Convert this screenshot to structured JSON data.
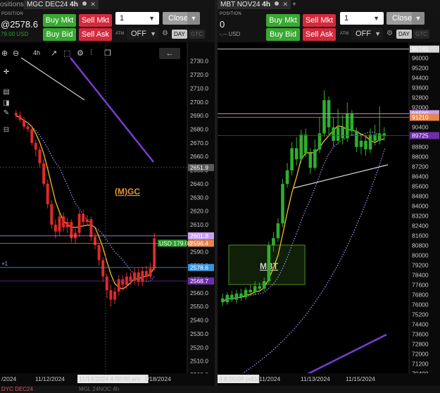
{
  "left": {
    "tabs": [
      {
        "label": "ositions"
      },
      {
        "label": "MGC DEC24",
        "interval": "4h"
      }
    ],
    "position_label": "POSITION",
    "position_value": "@2578.6",
    "position_sub": "79.00 USD",
    "buttons": {
      "buy_mkt": "Buy Mkt",
      "sell_mkt": "Sell Mkt",
      "buy_bid": "Buy Bid",
      "sell_ask": "Sell Ask",
      "close": "Close"
    },
    "quantity": "1",
    "atm_label": "ATM",
    "atm_value": "OFF",
    "tif": {
      "day": "DAY",
      "gtc": "GTC"
    },
    "toolbar_interval": "4h",
    "chart_data": {
      "type": "candlestick",
      "instrument": "MGC DEC24",
      "watermark": "(M)GC",
      "y_ticks": [
        "2730.0",
        "2720.0",
        "2710.0",
        "2700.0",
        "2690.0",
        "2680.0",
        "2670.0",
        "2660.0",
        "2650.0",
        "2640.0",
        "2630.0",
        "2620.0",
        "2610.0",
        "2600.0",
        "2590.0",
        "2580.0",
        "2570.0",
        "2560.0",
        "2550.0",
        "2540.0",
        "2530.0",
        "2520.0",
        "2510.0",
        "2500.0"
      ],
      "ylim": [
        2500,
        2735
      ],
      "x_labels": [
        "/2024",
        "11/12/2024",
        "11/14/2024 4:00:00 am",
        "1/18/2024"
      ],
      "price_tags": [
        {
          "label": "2651.9",
          "value": 2651.9,
          "color": "#5a5a5a"
        },
        {
          "label": "2601.8",
          "value": 2601.8,
          "color": "#c9a0f0"
        },
        {
          "label": "2596.4",
          "value": 2596.4,
          "color": "#e8864e"
        },
        {
          "label": "USD 179.00",
          "value": 2596.4,
          "color": "#2d9e2d"
        },
        {
          "label": "2578.6",
          "value": 2578.6,
          "color": "#3b93d6"
        },
        {
          "label": "2568.7",
          "value": 2568.7,
          "color": "#6e2ea8"
        }
      ],
      "qty_marker": "+1",
      "candles": [
        [
          2692,
          2690,
          2694,
          2688
        ],
        [
          2690,
          2687,
          2693,
          2685
        ],
        [
          2687,
          2682,
          2689,
          2680
        ],
        [
          2682,
          2680,
          2685,
          2678
        ],
        [
          2680,
          2670,
          2683,
          2668
        ],
        [
          2670,
          2665,
          2672,
          2660
        ],
        [
          2665,
          2655,
          2667,
          2652
        ],
        [
          2655,
          2640,
          2658,
          2638
        ],
        [
          2640,
          2625,
          2643,
          2622
        ],
        [
          2625,
          2610,
          2628,
          2607
        ],
        [
          2610,
          2605,
          2614,
          2600
        ],
        [
          2605,
          2616,
          2618,
          2602
        ],
        [
          2616,
          2608,
          2619,
          2605
        ],
        [
          2608,
          2612,
          2615,
          2604
        ],
        [
          2612,
          2600,
          2614,
          2597
        ],
        [
          2600,
          2604,
          2607,
          2596
        ],
        [
          2604,
          2618,
          2620,
          2601
        ],
        [
          2618,
          2612,
          2621,
          2608
        ],
        [
          2612,
          2614,
          2617,
          2609
        ],
        [
          2614,
          2601,
          2616,
          2598
        ],
        [
          2601,
          2595,
          2604,
          2592
        ],
        [
          2595,
          2584,
          2597,
          2580
        ],
        [
          2584,
          2572,
          2586,
          2568
        ],
        [
          2572,
          2562,
          2574,
          2556
        ],
        [
          2562,
          2555,
          2566,
          2550
        ],
        [
          2555,
          2561,
          2564,
          2552
        ],
        [
          2561,
          2570,
          2573,
          2558
        ],
        [
          2570,
          2566,
          2573,
          2562
        ],
        [
          2566,
          2572,
          2575,
          2563
        ],
        [
          2572,
          2569,
          2575,
          2566
        ],
        [
          2569,
          2575,
          2578,
          2566
        ],
        [
          2575,
          2568,
          2578,
          2565
        ],
        [
          2568,
          2576,
          2579,
          2565
        ],
        [
          2576,
          2572,
          2580,
          2569
        ],
        [
          2572,
          2578,
          2582,
          2570
        ],
        [
          2578,
          2600,
          2604,
          2576
        ]
      ]
    }
  },
  "right": {
    "tabs": [
      {
        "label": "MBT NOV24",
        "interval": "4h"
      }
    ],
    "position_label": "POSITION",
    "position_value": "0",
    "position_sub": "-.-- USD",
    "buttons": {
      "buy_mkt": "Buy Mkt",
      "sell_mkt": "Sell Mkt",
      "buy_bid": "Buy Bid",
      "sell_ask": "Sell Ask",
      "close": "Close"
    },
    "quantity": "1",
    "atm_label": "ATM",
    "atm_value": "OFF",
    "tif": {
      "day": "DAY",
      "gtc": "GTC"
    },
    "chart_data": {
      "type": "candlestick",
      "instrument": "MBT NOV24",
      "box_label": "MBT",
      "y_ticks": [
        "96745",
        "96000",
        "95200",
        "94400",
        "93600",
        "92800",
        "92000",
        "91200",
        "90400",
        "89600",
        "88800",
        "88000",
        "87200",
        "86400",
        "85600",
        "84800",
        "84000",
        "83200",
        "82400",
        "81600",
        "80800",
        "80000",
        "79200",
        "78400",
        "77600",
        "76800",
        "76000",
        "75200",
        "74400",
        "73600",
        "72800",
        "72000",
        "71200",
        "70400"
      ],
      "ylim": [
        70200,
        96900
      ],
      "x_labels": [
        "4 8:00:00 pm",
        "11/11/2024",
        "11/13/2024",
        "11/15/2024"
      ],
      "price_tags": [
        {
          "label": "96745",
          "value": 96745,
          "color": "#d9d9d9"
        },
        {
          "label": "91500",
          "value": 91500,
          "color": "#c9a0f0"
        },
        {
          "label": "91210",
          "value": 91210,
          "color": "#e8864e"
        },
        {
          "label": "89725",
          "value": 89725,
          "color": "#6e2ea8"
        }
      ],
      "candles": [
        [
          76500,
          76200,
          76900,
          75900
        ],
        [
          76200,
          76800,
          77000,
          76000
        ],
        [
          76800,
          76400,
          77100,
          76200
        ],
        [
          76400,
          76900,
          77200,
          76100
        ],
        [
          76900,
          76600,
          77300,
          76300
        ],
        [
          76600,
          77200,
          77400,
          76400
        ],
        [
          77200,
          77000,
          77600,
          76800
        ],
        [
          77000,
          77500,
          77900,
          76800
        ],
        [
          77500,
          77300,
          77800,
          77000
        ],
        [
          77300,
          77900,
          78200,
          77100
        ],
        [
          77900,
          80800,
          81100,
          77700
        ],
        [
          80800,
          81400,
          81900,
          80300
        ],
        [
          81400,
          82600,
          83000,
          81100
        ],
        [
          82600,
          85800,
          86200,
          82300
        ],
        [
          85800,
          86900,
          87500,
          85500
        ],
        [
          86900,
          88700,
          89200,
          86500
        ],
        [
          88700,
          87800,
          89600,
          87300
        ],
        [
          87800,
          89800,
          90200,
          87500
        ],
        [
          89800,
          88300,
          90300,
          88000
        ],
        [
          88300,
          87100,
          88700,
          86600
        ],
        [
          87100,
          88600,
          89400,
          86900
        ],
        [
          88600,
          89900,
          91200,
          88300
        ],
        [
          89900,
          92600,
          93400,
          89600
        ],
        [
          92600,
          90400,
          92900,
          89800
        ],
        [
          90400,
          89300,
          91200,
          88800
        ],
        [
          89300,
          90400,
          91900,
          89000
        ],
        [
          90400,
          89500,
          91400,
          89000
        ],
        [
          89500,
          91500,
          92400,
          89200
        ],
        [
          91500,
          90100,
          91800,
          89700
        ],
        [
          90100,
          88800,
          90400,
          88400
        ],
        [
          88800,
          89300,
          89700,
          88200
        ],
        [
          89300,
          88600,
          89800,
          88100
        ],
        [
          88600,
          89800,
          90300,
          88300
        ],
        [
          89800,
          89300,
          90600,
          88900
        ],
        [
          89300,
          89900,
          92100,
          89000
        ],
        [
          89900,
          89700,
          90400,
          89300
        ]
      ]
    }
  },
  "bottom": {
    "left_tab": "DYC DEC24",
    "right_tab": "MGL 24NOC 4h"
  }
}
